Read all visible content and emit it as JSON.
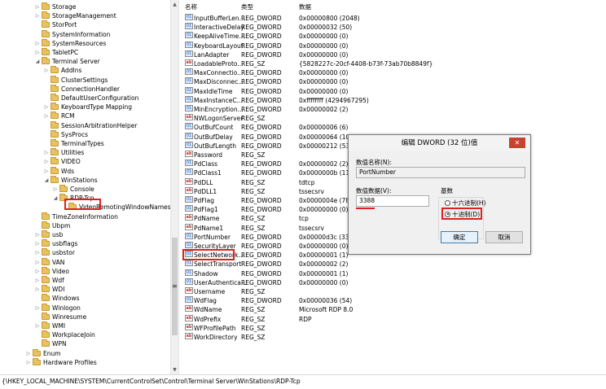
{
  "tree": {
    "items": [
      {
        "label": "Storage",
        "arrow": "▷",
        "level": 4
      },
      {
        "label": "StorageManagement",
        "arrow": "▷",
        "level": 4
      },
      {
        "label": "StorPort",
        "arrow": "",
        "level": 4
      },
      {
        "label": "SystemInformation",
        "arrow": "",
        "level": 4
      },
      {
        "label": "SystemResources",
        "arrow": "▷",
        "level": 4
      },
      {
        "label": "TabletPC",
        "arrow": "▷",
        "level": 4
      },
      {
        "label": "Terminal Server",
        "arrow": "◢",
        "level": 4
      },
      {
        "label": "AddIns",
        "arrow": "▷",
        "level": 5
      },
      {
        "label": "ClusterSettings",
        "arrow": "",
        "level": 5
      },
      {
        "label": "ConnectionHandler",
        "arrow": "",
        "level": 5
      },
      {
        "label": "DefaultUserConfiguration",
        "arrow": "",
        "level": 5
      },
      {
        "label": "KeyboardType Mapping",
        "arrow": "▷",
        "level": 5
      },
      {
        "label": "RCM",
        "arrow": "▷",
        "level": 5
      },
      {
        "label": "SessionArbitrationHelper",
        "arrow": "",
        "level": 5
      },
      {
        "label": "SysProcs",
        "arrow": "",
        "level": 5
      },
      {
        "label": "TerminalTypes",
        "arrow": "",
        "level": 5
      },
      {
        "label": "Utilities",
        "arrow": "▷",
        "level": 5
      },
      {
        "label": "VIDEO",
        "arrow": "▷",
        "level": 5
      },
      {
        "label": "Wds",
        "arrow": "▷",
        "level": 5
      },
      {
        "label": "WinStations",
        "arrow": "◢",
        "level": 5
      },
      {
        "label": "Console",
        "arrow": "▷",
        "level": 6
      },
      {
        "label": "RDP-Tcp",
        "arrow": "◢",
        "level": 6
      },
      {
        "label": "VideoRemotingWindowNames",
        "arrow": "",
        "level": 7
      },
      {
        "label": "TimeZoneInformation",
        "arrow": "",
        "level": 4
      },
      {
        "label": "Ubpm",
        "arrow": "",
        "level": 4
      },
      {
        "label": "usb",
        "arrow": "▷",
        "level": 4
      },
      {
        "label": "usbflags",
        "arrow": "▷",
        "level": 4
      },
      {
        "label": "usbstor",
        "arrow": "▷",
        "level": 4
      },
      {
        "label": "VAN",
        "arrow": "▷",
        "level": 4
      },
      {
        "label": "Video",
        "arrow": "▷",
        "level": 4
      },
      {
        "label": "Wdf",
        "arrow": "▷",
        "level": 4
      },
      {
        "label": "WDI",
        "arrow": "▷",
        "level": 4
      },
      {
        "label": "Windows",
        "arrow": "",
        "level": 4
      },
      {
        "label": "Winlogon",
        "arrow": "▷",
        "level": 4
      },
      {
        "label": "Winresume",
        "arrow": "",
        "level": 4
      },
      {
        "label": "WMI",
        "arrow": "▷",
        "level": 4
      },
      {
        "label": "WorkplaceJoin",
        "arrow": "",
        "level": 4
      },
      {
        "label": "WPN",
        "arrow": "",
        "level": 4
      },
      {
        "label": "Enum",
        "arrow": "▷",
        "level": 3
      },
      {
        "label": "Hardware Profiles",
        "arrow": "▷",
        "level": 3
      }
    ]
  },
  "list": {
    "headers": {
      "name": "名称",
      "type": "类型",
      "data": "数据"
    },
    "rows": [
      {
        "icon": "dword-icon",
        "name": "InputBufferLen...",
        "type": "REG_DWORD",
        "data": "0x00000800 (2048)"
      },
      {
        "icon": "dword-icon",
        "name": "InteractiveDelay",
        "type": "REG_DWORD",
        "data": "0x00000032 (50)"
      },
      {
        "icon": "dword-icon",
        "name": "KeepAliveTime...",
        "type": "REG_DWORD",
        "data": "0x00000000 (0)"
      },
      {
        "icon": "dword-icon",
        "name": "KeyboardLayout",
        "type": "REG_DWORD",
        "data": "0x00000000 (0)"
      },
      {
        "icon": "dword-icon",
        "name": "LanAdapter",
        "type": "REG_DWORD",
        "data": "0x00000000 (0)"
      },
      {
        "icon": "string-icon",
        "name": "LoadableProto...",
        "type": "REG_SZ",
        "data": "{5828227c-20cf-4408-b73f-73ab70b8849f}"
      },
      {
        "icon": "dword-icon",
        "name": "MaxConnectio...",
        "type": "REG_DWORD",
        "data": "0x00000000 (0)"
      },
      {
        "icon": "dword-icon",
        "name": "MaxDisconnec...",
        "type": "REG_DWORD",
        "data": "0x00000000 (0)"
      },
      {
        "icon": "dword-icon",
        "name": "MaxIdleTime",
        "type": "REG_DWORD",
        "data": "0x00000000 (0)"
      },
      {
        "icon": "dword-icon",
        "name": "MaxInstanceC...",
        "type": "REG_DWORD",
        "data": "0xffffffff (4294967295)"
      },
      {
        "icon": "dword-icon",
        "name": "MinEncryption...",
        "type": "REG_DWORD",
        "data": "0x00000002 (2)"
      },
      {
        "icon": "string-icon",
        "name": "NWLogonServer",
        "type": "REG_SZ",
        "data": ""
      },
      {
        "icon": "dword-icon",
        "name": "OutBufCount",
        "type": "REG_DWORD",
        "data": "0x00000006 (6)"
      },
      {
        "icon": "dword-icon",
        "name": "OutBufDelay",
        "type": "REG_DWORD",
        "data": "0x00000064 (100)"
      },
      {
        "icon": "dword-icon",
        "name": "OutBufLength",
        "type": "REG_DWORD",
        "data": "0x00000212 (530)"
      },
      {
        "icon": "string-icon",
        "name": "Password",
        "type": "REG_SZ",
        "data": ""
      },
      {
        "icon": "dword-icon",
        "name": "PdClass",
        "type": "REG_DWORD",
        "data": "0x00000002 (2)"
      },
      {
        "icon": "dword-icon",
        "name": "PdClass1",
        "type": "REG_DWORD",
        "data": "0x0000000b (11)"
      },
      {
        "icon": "string-icon",
        "name": "PdDLL",
        "type": "REG_SZ",
        "data": "tdtcp"
      },
      {
        "icon": "string-icon",
        "name": "PdDLL1",
        "type": "REG_SZ",
        "data": "tssecsrv"
      },
      {
        "icon": "dword-icon",
        "name": "PdFlag",
        "type": "REG_DWORD",
        "data": "0x0000004e (78)"
      },
      {
        "icon": "dword-icon",
        "name": "PdFlag1",
        "type": "REG_DWORD",
        "data": "0x00000000 (0)"
      },
      {
        "icon": "string-icon",
        "name": "PdName",
        "type": "REG_SZ",
        "data": "tcp"
      },
      {
        "icon": "string-icon",
        "name": "PdName1",
        "type": "REG_SZ",
        "data": "tssecsrv"
      },
      {
        "icon": "dword-icon",
        "name": "PortNumber",
        "type": "REG_DWORD",
        "data": "0x00000d3c (3388)"
      },
      {
        "icon": "dword-icon",
        "name": "SecurityLayer",
        "type": "REG_DWORD",
        "data": "0x00000000 (0)"
      },
      {
        "icon": "dword-icon",
        "name": "SelectNetwork...",
        "type": "REG_DWORD",
        "data": "0x00000001 (1)"
      },
      {
        "icon": "dword-icon",
        "name": "SelectTransport",
        "type": "REG_DWORD",
        "data": "0x00000002 (2)"
      },
      {
        "icon": "dword-icon",
        "name": "Shadow",
        "type": "REG_DWORD",
        "data": "0x00000001 (1)"
      },
      {
        "icon": "dword-icon",
        "name": "UserAuthentica...",
        "type": "REG_DWORD",
        "data": "0x00000000 (0)"
      },
      {
        "icon": "string-icon",
        "name": "Username",
        "type": "REG_SZ",
        "data": ""
      },
      {
        "icon": "dword-icon",
        "name": "WdFlag",
        "type": "REG_DWORD",
        "data": "0x00000036 (54)"
      },
      {
        "icon": "string-icon",
        "name": "WdName",
        "type": "REG_SZ",
        "data": "Microsoft RDP 8.0"
      },
      {
        "icon": "string-icon",
        "name": "WdPrefix",
        "type": "REG_SZ",
        "data": "RDP"
      },
      {
        "icon": "string-icon",
        "name": "WFProfilePath",
        "type": "REG_SZ",
        "data": ""
      },
      {
        "icon": "string-icon",
        "name": "WorkDirectory",
        "type": "REG_SZ",
        "data": ""
      }
    ]
  },
  "statusbar": {
    "path": "{\\HKEY_LOCAL_MACHINE\\SYSTEM\\CurrentControlSet\\Control\\Terminal Server\\WinStations\\RDP-Tcp"
  },
  "dialog": {
    "title": "编辑 DWORD (32 位)值",
    "close": "✕",
    "name_label": "数值名称(N):",
    "name_value": "PortNumber",
    "data_label": "数值数据(V):",
    "data_value": "3388",
    "base_label": "基数",
    "hex_label": "十六进制(H)",
    "dec_label": "十进制(D)",
    "selected_base": "decimal",
    "ok": "确定",
    "cancel": "取消"
  },
  "colors": {
    "highlight": "#e02020",
    "close_button": "#c7432f"
  }
}
